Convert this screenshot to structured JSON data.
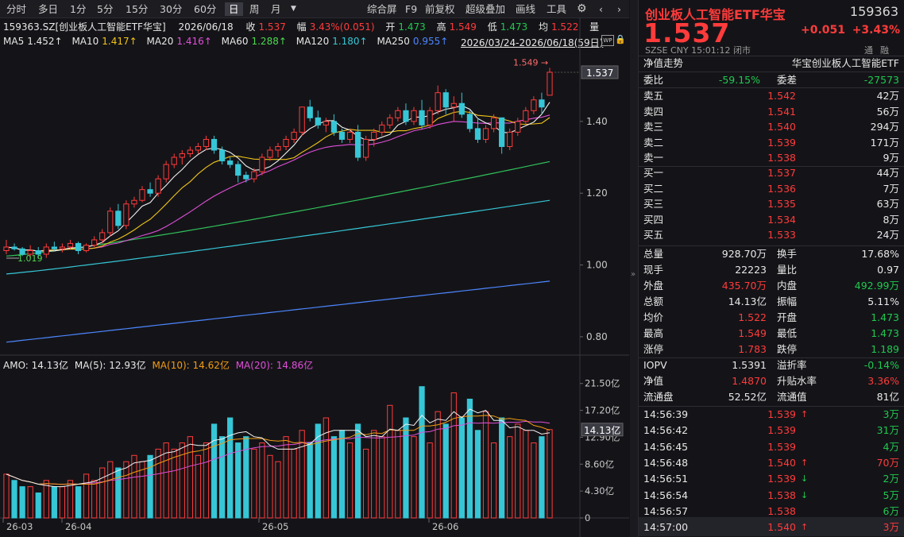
{
  "toolbar": {
    "periods": [
      "分时",
      "多日",
      "1分",
      "5分",
      "15分",
      "30分",
      "60分",
      "日",
      "周",
      "月"
    ],
    "active_period": "日",
    "tools": [
      "综合屏",
      "F9",
      "前复权",
      "超级叠加",
      "画线",
      "工具"
    ]
  },
  "header_info": {
    "code": "159363.SZ[创业板人工智能ETF华宝]",
    "date": "2026/06/18",
    "close_label": "收",
    "close": "1.537",
    "change_label": "幅",
    "change": "3.43%(0.051)",
    "open_label": "开",
    "open": "1.473",
    "high_label": "高",
    "high": "1.549",
    "low_label": "低",
    "low": "1.473",
    "avg_label": "均",
    "avg": "1.522",
    "vol_label": "量"
  },
  "ma_info": {
    "ma5": "MA5",
    "ma5_val": "1.452↑",
    "ma10": "MA10",
    "ma10_val": "1.417↑",
    "ma20": "MA20",
    "ma20_val": "1.416↑",
    "ma60": "MA60",
    "ma60_val": "1.288↑",
    "ma120": "MA120",
    "ma120_val": "1.180↑",
    "ma250": "MA250",
    "ma250_val": "0.955↑",
    "range": "2026/03/24-2026/06/18(59日)"
  },
  "vol_info": {
    "amo": "AMO: 14.13亿",
    "ma5": "MA(5): 12.93亿",
    "ma10": "MA(10): 14.62亿",
    "ma20": "MA(20): 14.86亿"
  },
  "chart_labels": {
    "price_ticks": [
      "1.40",
      "1.20",
      "1.00",
      "0.80"
    ],
    "current_price_tag": "1.537",
    "high_marker": "1.549",
    "low_marker": "1.019",
    "vol_ticks": [
      "21.50亿",
      "17.20亿",
      "12.90亿",
      "8.60亿",
      "4.30亿",
      "0"
    ],
    "vol_tag": "14.13亿",
    "date_ticks": [
      "26-03",
      "26-04",
      "26-05",
      "26-06"
    ]
  },
  "chart_data": {
    "type": "candlestick",
    "ylim": [
      0.76,
      1.59
    ],
    "candles": [
      {
        "o": 1.04,
        "h": 1.07,
        "l": 1.03,
        "c": 1.05
      },
      {
        "o": 1.05,
        "h": 1.06,
        "l": 1.04,
        "c": 1.045
      },
      {
        "o": 1.045,
        "h": 1.05,
        "l": 1.025,
        "c": 1.03
      },
      {
        "o": 1.03,
        "h": 1.055,
        "l": 1.02,
        "c": 1.04
      },
      {
        "o": 1.04,
        "h": 1.05,
        "l": 1.019,
        "c": 1.03
      },
      {
        "o": 1.03,
        "h": 1.06,
        "l": 1.02,
        "c": 1.05
      },
      {
        "o": 1.05,
        "h": 1.065,
        "l": 1.04,
        "c": 1.045
      },
      {
        "o": 1.045,
        "h": 1.06,
        "l": 1.035,
        "c": 1.05
      },
      {
        "o": 1.05,
        "h": 1.07,
        "l": 1.045,
        "c": 1.06
      },
      {
        "o": 1.06,
        "h": 1.065,
        "l": 1.03,
        "c": 1.04
      },
      {
        "o": 1.04,
        "h": 1.06,
        "l": 1.035,
        "c": 1.055
      },
      {
        "o": 1.055,
        "h": 1.08,
        "l": 1.05,
        "c": 1.07
      },
      {
        "o": 1.07,
        "h": 1.1,
        "l": 1.06,
        "c": 1.09
      },
      {
        "o": 1.09,
        "h": 1.16,
        "l": 1.08,
        "c": 1.15
      },
      {
        "o": 1.15,
        "h": 1.17,
        "l": 1.1,
        "c": 1.11
      },
      {
        "o": 1.11,
        "h": 1.18,
        "l": 1.1,
        "c": 1.17
      },
      {
        "o": 1.17,
        "h": 1.19,
        "l": 1.16,
        "c": 1.18
      },
      {
        "o": 1.18,
        "h": 1.22,
        "l": 1.175,
        "c": 1.21
      },
      {
        "o": 1.21,
        "h": 1.23,
        "l": 1.19,
        "c": 1.2
      },
      {
        "o": 1.2,
        "h": 1.25,
        "l": 1.19,
        "c": 1.24
      },
      {
        "o": 1.24,
        "h": 1.29,
        "l": 1.23,
        "c": 1.28
      },
      {
        "o": 1.28,
        "h": 1.31,
        "l": 1.27,
        "c": 1.3
      },
      {
        "o": 1.3,
        "h": 1.32,
        "l": 1.28,
        "c": 1.31
      },
      {
        "o": 1.31,
        "h": 1.33,
        "l": 1.3,
        "c": 1.32
      },
      {
        "o": 1.32,
        "h": 1.34,
        "l": 1.31,
        "c": 1.33
      },
      {
        "o": 1.33,
        "h": 1.36,
        "l": 1.32,
        "c": 1.35
      },
      {
        "o": 1.35,
        "h": 1.36,
        "l": 1.31,
        "c": 1.32
      },
      {
        "o": 1.32,
        "h": 1.33,
        "l": 1.28,
        "c": 1.29
      },
      {
        "o": 1.29,
        "h": 1.3,
        "l": 1.27,
        "c": 1.28
      },
      {
        "o": 1.28,
        "h": 1.29,
        "l": 1.23,
        "c": 1.25
      },
      {
        "o": 1.25,
        "h": 1.26,
        "l": 1.23,
        "c": 1.24
      },
      {
        "o": 1.24,
        "h": 1.27,
        "l": 1.23,
        "c": 1.26
      },
      {
        "o": 1.26,
        "h": 1.31,
        "l": 1.25,
        "c": 1.3
      },
      {
        "o": 1.3,
        "h": 1.33,
        "l": 1.29,
        "c": 1.32
      },
      {
        "o": 1.32,
        "h": 1.34,
        "l": 1.3,
        "c": 1.33
      },
      {
        "o": 1.33,
        "h": 1.36,
        "l": 1.32,
        "c": 1.35
      },
      {
        "o": 1.35,
        "h": 1.38,
        "l": 1.34,
        "c": 1.37
      },
      {
        "o": 1.37,
        "h": 1.44,
        "l": 1.36,
        "c": 1.44
      },
      {
        "o": 1.44,
        "h": 1.46,
        "l": 1.4,
        "c": 1.41
      },
      {
        "o": 1.41,
        "h": 1.43,
        "l": 1.38,
        "c": 1.39
      },
      {
        "o": 1.39,
        "h": 1.41,
        "l": 1.37,
        "c": 1.4
      },
      {
        "o": 1.4,
        "h": 1.42,
        "l": 1.36,
        "c": 1.37
      },
      {
        "o": 1.37,
        "h": 1.38,
        "l": 1.34,
        "c": 1.35
      },
      {
        "o": 1.35,
        "h": 1.38,
        "l": 1.34,
        "c": 1.37
      },
      {
        "o": 1.37,
        "h": 1.39,
        "l": 1.29,
        "c": 1.3
      },
      {
        "o": 1.3,
        "h": 1.36,
        "l": 1.29,
        "c": 1.35
      },
      {
        "o": 1.35,
        "h": 1.38,
        "l": 1.33,
        "c": 1.37
      },
      {
        "o": 1.37,
        "h": 1.4,
        "l": 1.36,
        "c": 1.39
      },
      {
        "o": 1.39,
        "h": 1.42,
        "l": 1.38,
        "c": 1.41
      },
      {
        "o": 1.41,
        "h": 1.44,
        "l": 1.4,
        "c": 1.43
      },
      {
        "o": 1.43,
        "h": 1.45,
        "l": 1.39,
        "c": 1.4
      },
      {
        "o": 1.4,
        "h": 1.44,
        "l": 1.39,
        "c": 1.43
      },
      {
        "o": 1.43,
        "h": 1.46,
        "l": 1.38,
        "c": 1.39
      },
      {
        "o": 1.39,
        "h": 1.44,
        "l": 1.38,
        "c": 1.43
      },
      {
        "o": 1.43,
        "h": 1.5,
        "l": 1.42,
        "c": 1.48
      },
      {
        "o": 1.48,
        "h": 1.49,
        "l": 1.42,
        "c": 1.44
      },
      {
        "o": 1.44,
        "h": 1.47,
        "l": 1.4,
        "c": 1.45
      },
      {
        "o": 1.45,
        "h": 1.48,
        "l": 1.41,
        "c": 1.42
      },
      {
        "o": 1.42,
        "h": 1.43,
        "l": 1.37,
        "c": 1.38
      },
      {
        "o": 1.38,
        "h": 1.41,
        "l": 1.34,
        "c": 1.35
      },
      {
        "o": 1.35,
        "h": 1.39,
        "l": 1.34,
        "c": 1.38
      },
      {
        "o": 1.38,
        "h": 1.42,
        "l": 1.37,
        "c": 1.41
      },
      {
        "o": 1.41,
        "h": 1.4,
        "l": 1.31,
        "c": 1.33
      },
      {
        "o": 1.33,
        "h": 1.38,
        "l": 1.32,
        "c": 1.37
      },
      {
        "o": 1.37,
        "h": 1.41,
        "l": 1.36,
        "c": 1.4
      },
      {
        "o": 1.4,
        "h": 1.44,
        "l": 1.39,
        "c": 1.43
      },
      {
        "o": 1.43,
        "h": 1.47,
        "l": 1.42,
        "c": 1.46
      },
      {
        "o": 1.46,
        "h": 1.48,
        "l": 1.42,
        "c": 1.44
      },
      {
        "o": 1.473,
        "h": 1.549,
        "l": 1.473,
        "c": 1.537
      }
    ],
    "ma5_color": "#f0f0f0",
    "ma10_color": "#f0c419",
    "ma20_color": "#e04fd8",
    "ma60_color": "#31c05a",
    "ma120_color": "#36c6d6",
    "ma250_color": "#4d86ff",
    "ma60_range": [
      1.025,
      1.288
    ],
    "ma120_range": [
      0.975,
      1.18
    ],
    "ma250_range": [
      0.785,
      0.955
    ],
    "volume_ylim": [
      0,
      23.5
    ],
    "volumes": [
      7,
      6,
      5,
      5,
      4,
      6,
      5,
      5,
      6,
      5,
      7,
      6,
      8,
      9,
      8,
      9,
      10,
      9,
      10,
      11,
      12,
      11,
      12,
      13,
      10,
      12,
      15,
      13,
      16,
      12,
      13,
      11,
      12,
      10,
      9,
      13,
      11,
      14,
      12,
      15,
      16,
      13,
      14,
      12,
      15,
      11,
      14,
      13,
      18,
      14,
      16,
      13,
      21,
      12,
      17,
      15,
      20,
      16,
      19,
      14,
      17,
      12,
      16,
      13,
      15,
      14,
      12,
      13,
      14.13
    ],
    "up_color": "#ff3b3b",
    "down_color": "#36c6d6"
  },
  "panel": {
    "name": "创业板人工智能ETF华宝",
    "code": "159363",
    "price": "1.537",
    "change": "+0.051",
    "change_pct": "+3.43%",
    "market": "SZSE",
    "currency": "CNY",
    "time": "15:01:12",
    "status": "闭市",
    "tags": [
      "通",
      "融"
    ],
    "nav_label": "净值走势",
    "nav_name": "华宝创业板人工智能ETF",
    "weibi_label": "委比",
    "weibi": "-59.15%",
    "weicha_label": "委差",
    "weicha": "-27573",
    "asks": [
      {
        "label": "卖五",
        "price": "1.542",
        "vol": "42万"
      },
      {
        "label": "卖四",
        "price": "1.541",
        "vol": "56万"
      },
      {
        "label": "卖三",
        "price": "1.540",
        "vol": "294万"
      },
      {
        "label": "卖二",
        "price": "1.539",
        "vol": "171万"
      },
      {
        "label": "卖一",
        "price": "1.538",
        "vol": "9万"
      }
    ],
    "bids": [
      {
        "label": "买一",
        "price": "1.537",
        "vol": "44万"
      },
      {
        "label": "买二",
        "price": "1.536",
        "vol": "7万"
      },
      {
        "label": "买三",
        "price": "1.535",
        "vol": "63万"
      },
      {
        "label": "买四",
        "price": "1.534",
        "vol": "8万"
      },
      {
        "label": "买五",
        "price": "1.533",
        "vol": "24万"
      }
    ],
    "stats": [
      {
        "l1": "总量",
        "v1": "928.70万",
        "l2": "换手",
        "v2": "17.68%",
        "c1": "white",
        "c2": "white"
      },
      {
        "l1": "现手",
        "v1": "22223",
        "l2": "量比",
        "v2": "0.97",
        "c1": "white",
        "c2": "white"
      },
      {
        "l1": "外盘",
        "v1": "435.70万",
        "l2": "内盘",
        "v2": "492.99万",
        "c1": "red",
        "c2": "green"
      },
      {
        "l1": "总额",
        "v1": "14.13亿",
        "l2": "振幅",
        "v2": "5.11%",
        "c1": "white",
        "c2": "white"
      },
      {
        "l1": "均价",
        "v1": "1.522",
        "l2": "开盘",
        "v2": "1.473",
        "c1": "red",
        "c2": "green"
      },
      {
        "l1": "最高",
        "v1": "1.549",
        "l2": "最低",
        "v2": "1.473",
        "c1": "red",
        "c2": "green"
      },
      {
        "l1": "涨停",
        "v1": "1.783",
        "l2": "跌停",
        "v2": "1.189",
        "c1": "red",
        "c2": "green"
      }
    ],
    "iopv": [
      {
        "l1": "IOPV",
        "v1": "1.5391",
        "l2": "溢折率",
        "v2": "-0.14%",
        "c1": "white",
        "c2": "green"
      },
      {
        "l1": "净值",
        "v1": "1.4870",
        "l2": "升贴水率",
        "v2": "3.36%",
        "c1": "red",
        "c2": "red"
      },
      {
        "l1": "流通盘",
        "v1": "52.52亿",
        "l2": "流通值",
        "v2": "81亿",
        "c1": "white",
        "c2": "white"
      }
    ],
    "ticks": [
      {
        "time": "14:56:39",
        "price": "1.539",
        "arrow": "up",
        "vol": "3万",
        "vc": "green"
      },
      {
        "time": "14:56:42",
        "price": "1.539",
        "arrow": "",
        "vol": "31万",
        "vc": "green"
      },
      {
        "time": "14:56:45",
        "price": "1.539",
        "arrow": "",
        "vol": "4万",
        "vc": "green"
      },
      {
        "time": "14:56:48",
        "price": "1.540",
        "arrow": "up",
        "vol": "70万",
        "vc": "red"
      },
      {
        "time": "14:56:51",
        "price": "1.539",
        "arrow": "down",
        "vol": "2万",
        "vc": "green"
      },
      {
        "time": "14:56:54",
        "price": "1.538",
        "arrow": "down",
        "vol": "5万",
        "vc": "green"
      },
      {
        "time": "14:56:57",
        "price": "1.538",
        "arrow": "",
        "vol": "6万",
        "vc": "green"
      },
      {
        "time": "14:57:00",
        "price": "1.540",
        "arrow": "up",
        "vol": "3万",
        "vc": "red"
      }
    ]
  }
}
